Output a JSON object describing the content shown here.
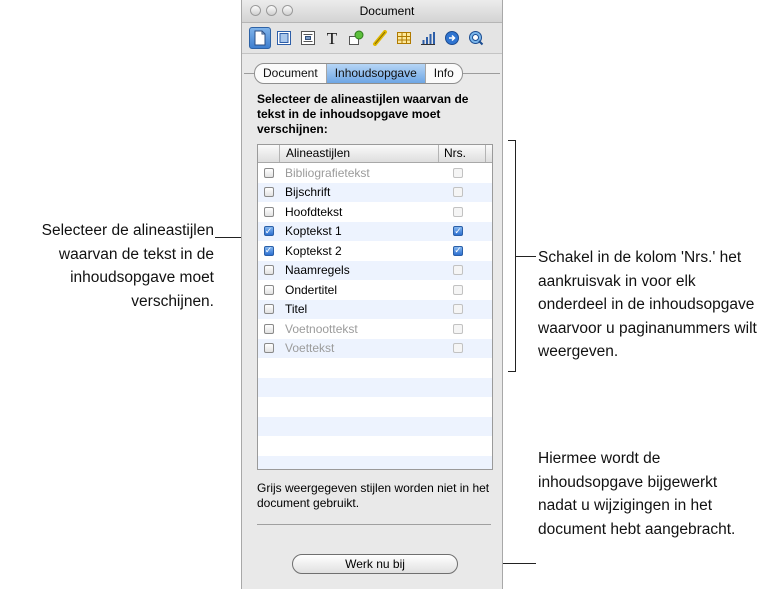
{
  "window": {
    "title": "Document"
  },
  "toolbar": {
    "buttons": [
      {
        "icon": "document-icon"
      },
      {
        "icon": "layout-icon"
      },
      {
        "icon": "wrap-icon"
      },
      {
        "icon": "text-icon"
      },
      {
        "icon": "graphic-icon"
      },
      {
        "icon": "metrics-icon"
      },
      {
        "icon": "table-icon"
      },
      {
        "icon": "chart-icon"
      },
      {
        "icon": "link-icon"
      },
      {
        "icon": "quicktime-icon"
      }
    ]
  },
  "tabs": [
    {
      "label": "Document",
      "selected": false
    },
    {
      "label": "Inhoudsopgave",
      "selected": true
    },
    {
      "label": "Info",
      "selected": false
    }
  ],
  "instruction": "Selecteer de alineastijlen waarvan de tekst in de inhoudsopgave moet verschijnen:",
  "table": {
    "headers": {
      "name": "Alineastijlen",
      "nrs": "Nrs."
    },
    "rows": [
      {
        "name": "Bibliografietekst",
        "checked": false,
        "nrs": false,
        "disabled": true
      },
      {
        "name": "Bijschrift",
        "checked": false,
        "nrs": false,
        "disabled": false
      },
      {
        "name": "Hoofdtekst",
        "checked": false,
        "nrs": false,
        "disabled": false
      },
      {
        "name": "Koptekst 1",
        "checked": true,
        "nrs": true,
        "disabled": false
      },
      {
        "name": "Koptekst 2",
        "checked": true,
        "nrs": true,
        "disabled": false
      },
      {
        "name": "Naamregels",
        "checked": false,
        "nrs": false,
        "disabled": false
      },
      {
        "name": "Ondertitel",
        "checked": false,
        "nrs": false,
        "disabled": false
      },
      {
        "name": "Titel",
        "checked": false,
        "nrs": false,
        "disabled": false
      },
      {
        "name": "Voetnoottekst",
        "checked": false,
        "nrs": false,
        "disabled": true
      },
      {
        "name": "Voettekst",
        "checked": false,
        "nrs": false,
        "disabled": true
      }
    ]
  },
  "footnote": "Grijs weergegeven stijlen worden niet in het document gebruikt.",
  "update_button": "Werk nu bij",
  "callouts": {
    "left": "Selecteer de alineastijlen waarvan de tekst in de inhoudsopgave moet verschijnen.",
    "right": "Schakel in de kolom 'Nrs.' het aankruisvak in voor elk onderdeel in de inhoudsopgave waarvoor u paginanummers wilt weergeven.",
    "bottom": "Hiermee wordt de inhoudsopgave bijgewerkt nadat u wijzigingen in het document hebt aangebracht."
  },
  "colors": {
    "accent": "#3f7fcf",
    "selected_tab": "#6ea6e5",
    "row_alt": "#edf3fe"
  }
}
